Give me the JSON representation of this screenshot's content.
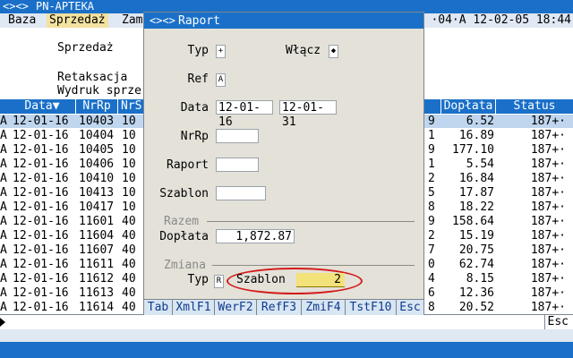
{
  "app": {
    "title": "PN-APTEKA"
  },
  "menu": {
    "items": [
      "Baza",
      "Sprzedaż",
      "Zam"
    ],
    "status_right": "·04·A 12-02-05 18:44"
  },
  "dropdown": {
    "items": [
      "Sprzedaż",
      "Retaksacja",
      "Wydruk sprze"
    ]
  },
  "table": {
    "left_headers": [
      "Data▼",
      "NrRp",
      "NrS"
    ],
    "right_headers": [
      "Dopłata",
      "Status"
    ],
    "rows": [
      {
        "p": "A",
        "date": "12-01-16",
        "nrrp": "10403",
        "nrs": "10",
        "c": "9",
        "doplata": "6.52",
        "status": "187+·"
      },
      {
        "p": "A",
        "date": "12-01-16",
        "nrrp": "10404",
        "nrs": "10",
        "c": "1",
        "doplata": "16.89",
        "status": "187+·"
      },
      {
        "p": "A",
        "date": "12-01-16",
        "nrrp": "10405",
        "nrs": "10",
        "c": "9",
        "doplata": "177.10",
        "status": "187+·"
      },
      {
        "p": "A",
        "date": "12-01-16",
        "nrrp": "10406",
        "nrs": "10",
        "c": "1",
        "doplata": "5.54",
        "status": "187+·"
      },
      {
        "p": "A",
        "date": "12-01-16",
        "nrrp": "10410",
        "nrs": "10",
        "c": "2",
        "doplata": "16.84",
        "status": "187+·"
      },
      {
        "p": "A",
        "date": "12-01-16",
        "nrrp": "10413",
        "nrs": "10",
        "c": "5",
        "doplata": "17.87",
        "status": "187+·"
      },
      {
        "p": "A",
        "date": "12-01-16",
        "nrrp": "10417",
        "nrs": "10",
        "c": "8",
        "doplata": "18.22",
        "status": "187+·"
      },
      {
        "p": "A",
        "date": "12-01-16",
        "nrrp": "11601",
        "nrs": "40",
        "c": "9",
        "doplata": "158.64",
        "status": "187+·"
      },
      {
        "p": "A",
        "date": "12-01-16",
        "nrrp": "11604",
        "nrs": "40",
        "c": "2",
        "doplata": "15.19",
        "status": "187+·"
      },
      {
        "p": "A",
        "date": "12-01-16",
        "nrrp": "11607",
        "nrs": "40",
        "c": "7",
        "doplata": "20.75",
        "status": "187+·"
      },
      {
        "p": "A",
        "date": "12-01-16",
        "nrrp": "11611",
        "nrs": "40",
        "c": "0",
        "doplata": "62.74",
        "status": "187+·"
      },
      {
        "p": "A",
        "date": "12-01-16",
        "nrrp": "11612",
        "nrs": "40",
        "c": "4",
        "doplata": "8.15",
        "status": "187+·"
      },
      {
        "p": "A",
        "date": "12-01-16",
        "nrrp": "11613",
        "nrs": "40",
        "c": "6",
        "doplata": "12.36",
        "status": "187+·"
      },
      {
        "p": "A",
        "date": "12-01-16",
        "nrrp": "11614",
        "nrs": "40",
        "c": "8",
        "doplata": "20.52",
        "status": "187+·"
      }
    ]
  },
  "bottom": {
    "esc_label": "Esc"
  },
  "dialog": {
    "title": "Raport",
    "typ_label": "Typ",
    "typ_value": "+",
    "wlacz_label": "Włącz",
    "wlacz_value": "◆",
    "ref_label": "Ref",
    "ref_value": "A",
    "data_label": "Data",
    "date_from": "12-01-16",
    "date_to": "12-01-31",
    "nrrp_label": "NrRp",
    "nrrp_value": "",
    "raport_label": "Raport",
    "raport_value": "",
    "szablon_label": "Szablon",
    "szablon_value": "",
    "razem_label": "Razem",
    "doplata_label": "Dopłata",
    "doplata_value": "1,872.87",
    "zmiana_label": "Zmiana",
    "typ2_label": "Typ",
    "typ2_value": "R",
    "szablon2_label": "Szablon",
    "szablon2_value": "2",
    "fkeys": [
      "Tab",
      "XmlF1",
      "WerF2",
      "RefF3",
      "ZmiF4",
      "TstF10",
      "Esc"
    ]
  },
  "colors": {
    "accent": "#1a70c8",
    "highlight_row": "#bfd6ee",
    "field_active": "#f3e27a",
    "oval": "#d21a1a"
  }
}
